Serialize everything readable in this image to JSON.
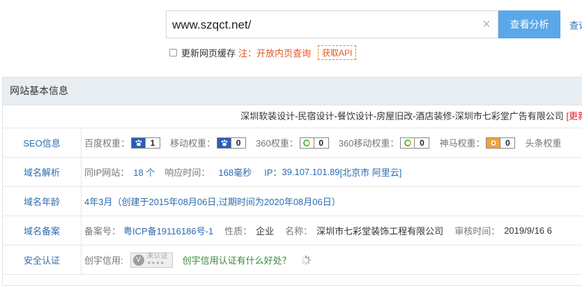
{
  "search": {
    "value": "www.szqct.net/",
    "button": "查看分析",
    "button2": "查诘"
  },
  "options": {
    "refresh_label": "更新网页缓存",
    "note": "注：开放内页查询",
    "api_button": "获取API"
  },
  "panel": {
    "heading": "网站基本信息",
    "site_title": "深圳软装设计-民宿设计-餐饮设计-房屋旧改-酒店装修-深圳市七彩堂广告有限公司",
    "update_label": "[更新"
  },
  "seo": {
    "label": "SEO信息",
    "items": [
      {
        "name": "百度权重：",
        "icon": "paw-icon",
        "value": "1"
      },
      {
        "name": "移动权重：",
        "icon": "paw-icon",
        "value": "0"
      },
      {
        "name": "360权重：",
        "icon": "ring-icon",
        "value": "0"
      },
      {
        "name": "360移动权重：",
        "icon": "ring-icon",
        "value": "0"
      },
      {
        "name": "神马权重：",
        "icon": "horse-icon",
        "value": "0"
      },
      {
        "name": "头条权重",
        "icon": "",
        "value": ""
      }
    ]
  },
  "dns": {
    "label": "域名解析",
    "sameip_label": "同IP网站：",
    "sameip_value": "18 个",
    "resp_label": "响应时间：",
    "resp_value": "168毫秒",
    "ip_label": "IP：",
    "ip_value": "39.107.101.89",
    "ip_loc": "[北京市 阿里云]"
  },
  "age": {
    "label": "域名年龄",
    "value": "4年3月（创建于2015年08月06日,过期时间为2020年08月06日）"
  },
  "icp": {
    "label": "域名备案",
    "no_label": "备案号：",
    "no_value": "粤ICP备19116186号-1",
    "type_label": "性质：",
    "type_value": "企业",
    "name_label": "名称：",
    "name_value": "深圳市七彩堂装饰工程有限公司",
    "date_label": "审核时间：",
    "date_value": "2019/9/16 6"
  },
  "security": {
    "label": "安全认证",
    "cx_label": "创宇信用:",
    "badge_text": "未认证",
    "badge_stars": "★★★★",
    "link": "创宇信用认证有什么好处？"
  }
}
